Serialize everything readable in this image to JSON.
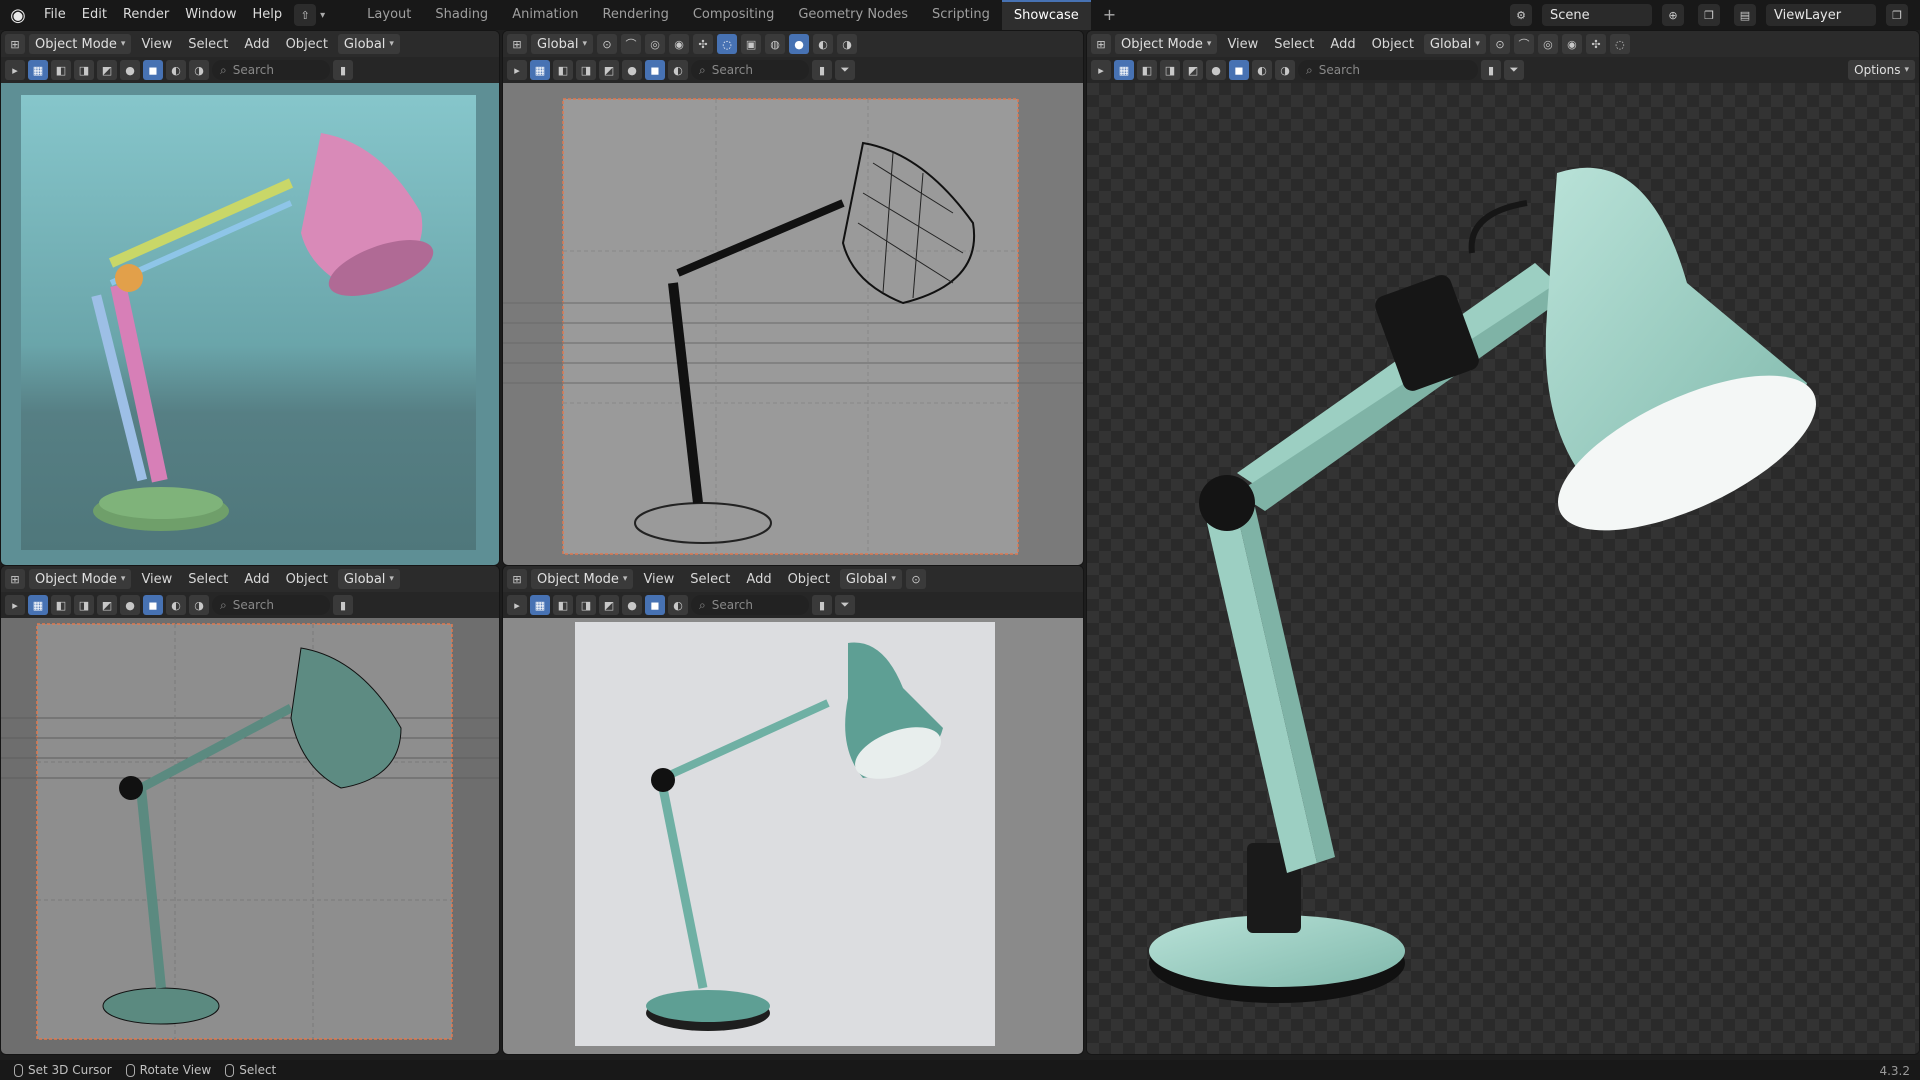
{
  "menu": [
    "File",
    "Edit",
    "Render",
    "Window",
    "Help"
  ],
  "tabs": [
    {
      "label": "Layout",
      "active": false
    },
    {
      "label": "Shading",
      "active": false
    },
    {
      "label": "Animation",
      "active": false
    },
    {
      "label": "Rendering",
      "active": false
    },
    {
      "label": "Compositing",
      "active": false
    },
    {
      "label": "Geometry Nodes",
      "active": false
    },
    {
      "label": "Scripting",
      "active": false
    },
    {
      "label": "Showcase",
      "active": true
    }
  ],
  "tab_add": "+",
  "scene": {
    "name": "Scene",
    "view_layer": "ViewLayer"
  },
  "viewport": {
    "mode": "Object Mode",
    "menu": [
      "View",
      "Select",
      "Add",
      "Object"
    ],
    "transform": "Global",
    "search_placeholder": "Search",
    "options": "Options"
  },
  "status": {
    "items": [
      "Set 3D Cursor",
      "Rotate View",
      "Select"
    ],
    "version": "4.3.2"
  },
  "colors": {
    "accent": "#4772b3",
    "lamp": "#9cd3c5",
    "clay_bg": "#7fb8bd"
  }
}
